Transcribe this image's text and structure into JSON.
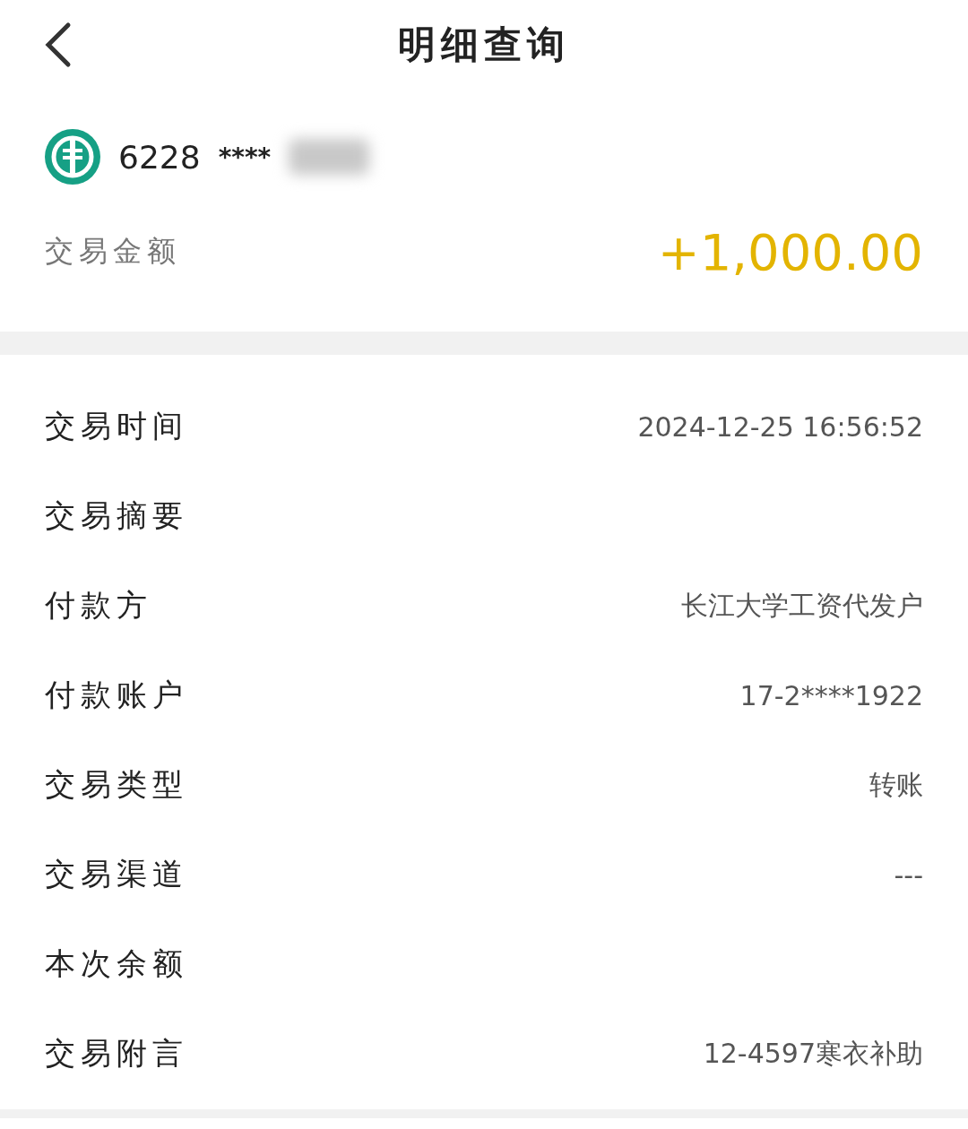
{
  "header": {
    "title": "明细查询"
  },
  "account": {
    "number": "6228",
    "masked": "****"
  },
  "amount": {
    "label": "交易金额",
    "value": "+1,000.00"
  },
  "details": [
    {
      "label": "交易时间",
      "value": "2024-12-25  16:56:52"
    },
    {
      "label": "交易摘要"
    },
    {
      "label": "付款方",
      "value": "长江大学工资代发户"
    },
    {
      "label": "付款账户",
      "value": "17-2****1922"
    },
    {
      "label": "交易类型",
      "value": "转账"
    },
    {
      "label": "交易渠道",
      "value": "---"
    },
    {
      "label": "本次余额"
    },
    {
      "label": "交易附言",
      "value": "12-4597寒衣补助"
    }
  ]
}
